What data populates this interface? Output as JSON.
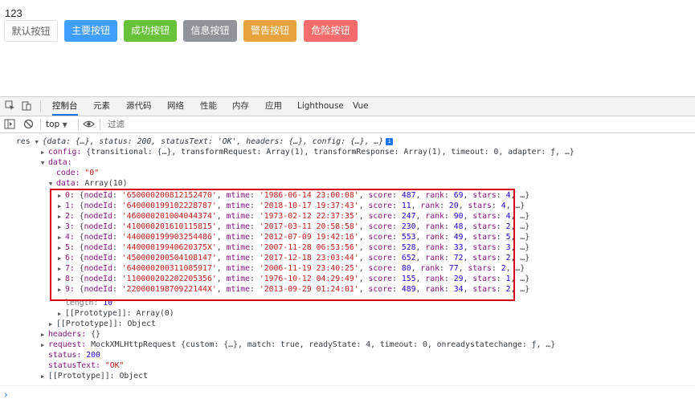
{
  "page": {
    "text": "123",
    "buttons": {
      "default": "默认按钮",
      "primary": "主要按钮",
      "success": "成功按钮",
      "info": "信息按钮",
      "warning": "警告按钮",
      "danger": "危险按钮"
    }
  },
  "devtools": {
    "tabs": [
      "控制台",
      "元素",
      "源代码",
      "网络",
      "性能",
      "内存",
      "应用",
      "Lighthouse",
      "Vue"
    ],
    "active_tab": "控制台",
    "context": "top",
    "filter_placeholder": "过滤"
  },
  "console": {
    "res_label": "res",
    "res_summary": "{data: {…}, status: 200, statusText: 'OK', headers: {…}, config: {…}, …}",
    "config_key": "config:",
    "config_value": "{transitional: {…}, transformRequest: Array(1), transformResponse: Array(1), timeout: 0, adapter: ƒ, …}",
    "data_key": "data:",
    "code_key": "code:",
    "code_value": "\"0\"",
    "inner_data_key": "data:",
    "inner_data_value": "Array(10)",
    "rows": [
      {
        "idx": "0:",
        "nodeId": "'650000200812152470'",
        "mtime": "'1986-06-14 23:00:08'",
        "score": "487",
        "rank": "69",
        "stars": "4"
      },
      {
        "idx": "1:",
        "nodeId": "'640000199102228787'",
        "mtime": "'2018-10-17 19:37:43'",
        "score": "11",
        "rank": "20",
        "stars": "4"
      },
      {
        "idx": "2:",
        "nodeId": "'460000201004044374'",
        "mtime": "'1973-02-12 22:37:35'",
        "score": "247",
        "rank": "90",
        "stars": "4"
      },
      {
        "idx": "3:",
        "nodeId": "'410000201610115815'",
        "mtime": "'2017-03-11 20:58:58'",
        "score": "230",
        "rank": "48",
        "stars": "2"
      },
      {
        "idx": "4:",
        "nodeId": "'440000199903254486'",
        "mtime": "'2012-07-09 19:42:16'",
        "score": "553",
        "rank": "49",
        "stars": "5"
      },
      {
        "idx": "5:",
        "nodeId": "'44000019940620375X'",
        "mtime": "'2007-11-28 06:53:56'",
        "score": "528",
        "rank": "33",
        "stars": "3"
      },
      {
        "idx": "6:",
        "nodeId": "'450000200504108147'",
        "mtime": "'2017-12-18 23:03:44'",
        "score": "652",
        "rank": "72",
        "stars": "2"
      },
      {
        "idx": "7:",
        "nodeId": "'640000200311085917'",
        "mtime": "'2006-11-19 23:40:25'",
        "score": "80",
        "rank": "77",
        "stars": "2"
      },
      {
        "idx": "8:",
        "nodeId": "'110000202202205356'",
        "mtime": "'1976-10-12 04:29:49'",
        "score": "155",
        "rank": "29",
        "stars": "1"
      },
      {
        "idx": "9:",
        "nodeId": "'22000019870922144X'",
        "mtime": "'2013-09-29 01:24:01'",
        "score": "489",
        "rank": "34",
        "stars": "2"
      }
    ],
    "length_key": "length:",
    "length_value": "10",
    "proto_array": "[[Prototype]]: Array(0)",
    "proto_object": "[[Prototype]]: Object",
    "headers_key": "headers:",
    "headers_value": "{}",
    "request_key": "request:",
    "request_value": "MockXMLHttpRequest {custom: {…}, match: true, readyState: 4, timeout: 0, onreadystatechange: ƒ, …}",
    "status_key": "status:",
    "status_value": "200",
    "statusText_key": "statusText:",
    "statusText_value": "\"OK\"",
    "proto_root": "[[Prototype]]: Object",
    "prompt": "›"
  }
}
